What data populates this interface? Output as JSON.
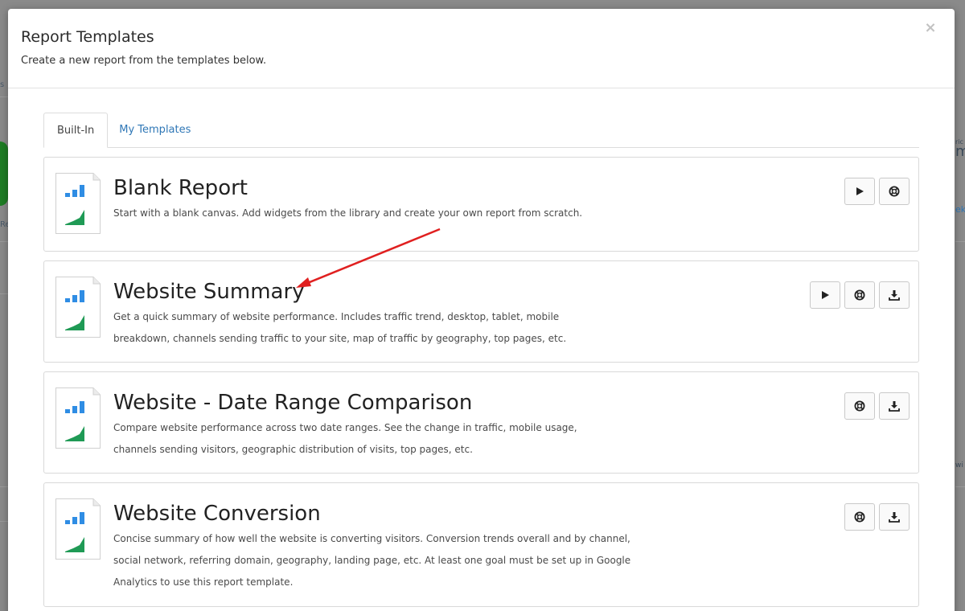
{
  "modal": {
    "title": "Report Templates",
    "subtitle": "Create a new report from the templates below.",
    "close_label": "×"
  },
  "tabs": [
    {
      "label": "Built-In",
      "active": true
    },
    {
      "label": "My Templates",
      "active": false
    }
  ],
  "templates": [
    {
      "title": "Blank Report",
      "description": "Start with a blank canvas. Add widgets from the library and create your own report from scratch.",
      "actions": [
        "play-icon",
        "lifebuoy-icon"
      ]
    },
    {
      "title": "Website Summary",
      "description": "Get a quick summary of website performance. Includes traffic trend, desktop, tablet, mobile breakdown, channels sending traffic to your site, map of traffic by geography, top pages, etc.",
      "actions": [
        "play-icon",
        "lifebuoy-icon",
        "download-icon"
      ]
    },
    {
      "title": "Website - Date Range Comparison",
      "description": "Compare website performance across two date ranges. See the change in traffic, mobile usage, channels sending visitors, geographic distribution of visits, top pages, etc.",
      "actions": [
        "lifebuoy-icon",
        "download-icon"
      ]
    },
    {
      "title": "Website Conversion",
      "description": "Concise summary of how well the website is converting visitors. Conversion trends overall and by channel, social network, referring domain, geography, landing page, etc. At least one goal must be set up in Google Analytics to use this report template.",
      "actions": [
        "lifebuoy-icon",
        "download-icon"
      ]
    }
  ],
  "background": {
    "left_snippets": [
      "s",
      "Re"
    ],
    "right_snippets": [
      "ric",
      "m",
      "ek",
      "wi"
    ]
  },
  "colors": {
    "bar_blue": "#2f8de4",
    "area_green": "#1f9a55",
    "link_blue": "#2f77b6",
    "annotation_red": "#e02020",
    "bg_green": "#1e7d24"
  },
  "annotation": {
    "type": "arrow",
    "points_to": "Website Summary"
  }
}
